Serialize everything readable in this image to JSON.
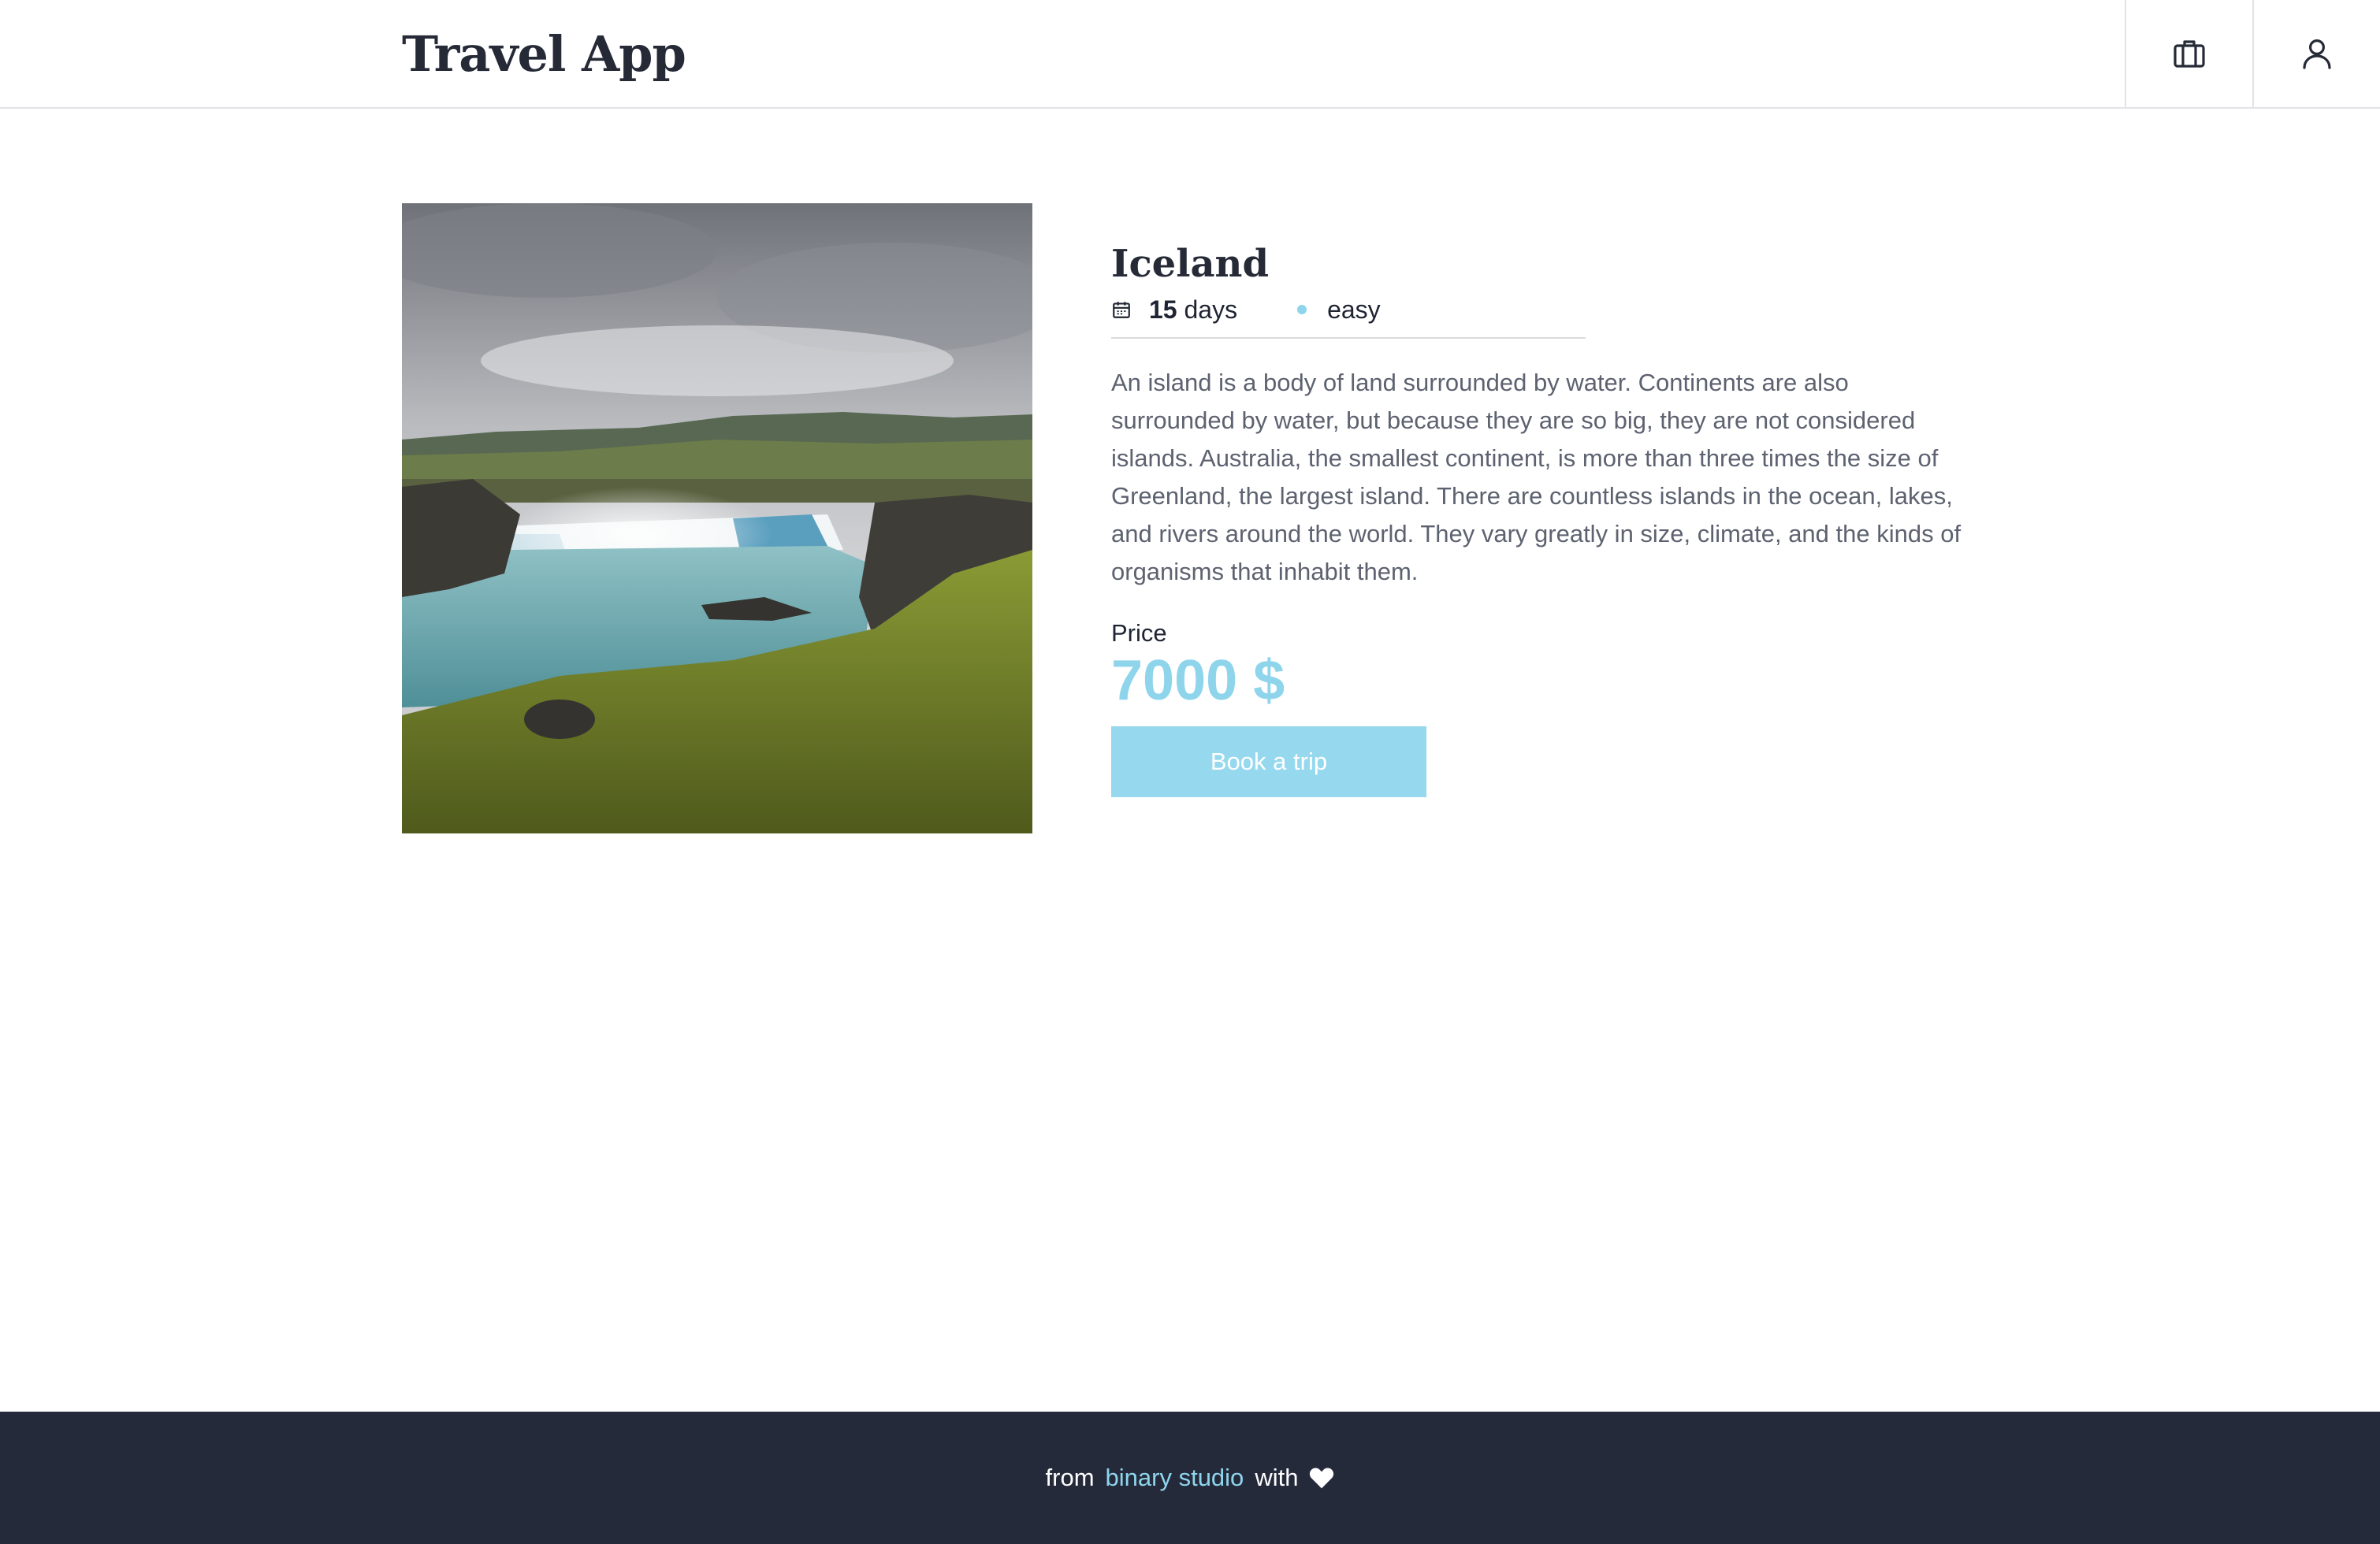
{
  "header": {
    "logo": "Travel App",
    "bookings_icon": "briefcase-icon",
    "profile_icon": "user-icon"
  },
  "trip": {
    "image_alt": "Waterfall landscape in Iceland",
    "title": "Iceland",
    "duration_value": "15",
    "duration_unit": "days",
    "level": "easy",
    "description": "An island is a body of land surrounded by water. Continents are also surrounded by water, but because they are so big, they are not considered islands. Australia, the smallest continent, is more than three times the size of Greenland, the largest island. There are countless islands in the ocean, lakes, and rivers around the world. They vary greatly in size, climate, and the kinds of organisms that inhabit them.",
    "price_label": "Price",
    "price_value": "7000 $",
    "book_button": "Book a trip"
  },
  "footer": {
    "prefix": "from",
    "brand": "binary studio",
    "suffix": "with",
    "heart_icon": "heart-icon"
  },
  "colors": {
    "accent": "#8ed5ec",
    "footer_bg": "#252a3b",
    "text_dark": "#252a36",
    "text_muted": "#5d6270"
  }
}
